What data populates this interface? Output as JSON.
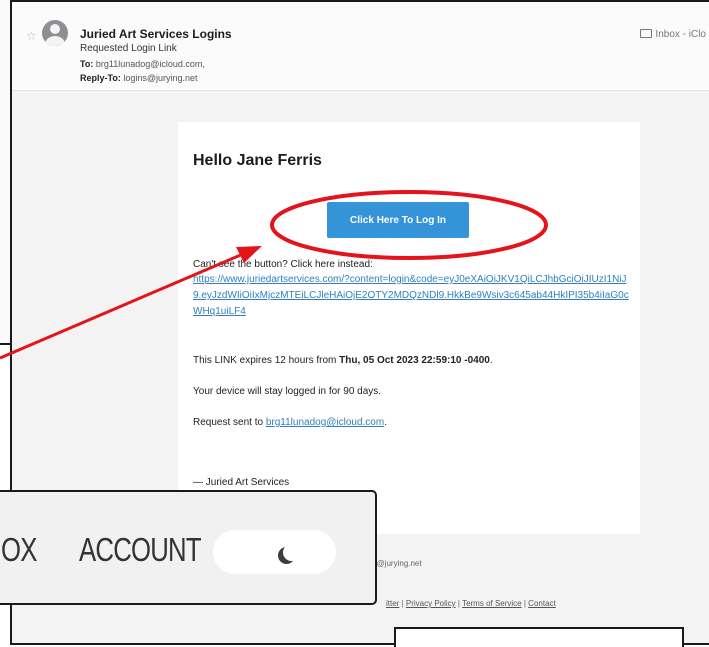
{
  "email": {
    "sender": "Juried Art Services Logins",
    "subject": "Requested Login Link",
    "to_label": "To:",
    "to_value": "brg11lunadog@icloud.com,",
    "reply_label": "Reply-To:",
    "reply_value": "logins@jurying.net",
    "mailbox": "Inbox - iClo"
  },
  "body": {
    "greeting": "Hello Jane Ferris",
    "button_label": "Click Here To Log In",
    "cant_see": "Can't see the button? Click here instead:",
    "link": "https://www.juriedartservices.com/?content=login&code=eyJ0eXAiOiJKV1QiLCJhbGciOiJIUzI1NiJ9.eyJzdWIiOiIxMjczMTEiLCJleHAiOjE2OTY2MDQzNDl9.HkkBe9Wsiv3c645ab44HkIPI35b4iIaG0cWHq1uiLF4",
    "expires_prefix": "This LINK expires 12 hours from ",
    "expires_date": "Thu, 05 Oct 2023 22:59:10 -0400",
    "expires_suffix": ".",
    "device": "Your device will stay logged in for 90 days.",
    "request_prefix": "Request sent to ",
    "request_email": "brg11lunadog@icloud.com",
    "request_suffix": ".",
    "signoff": "— Juried Art Services"
  },
  "footer": {
    "sent_by": "by logins@jurying.net",
    "link_twitter": "itter",
    "sep": " | ",
    "link_privacy": "Privacy Policy",
    "link_terms": "Terms of Service",
    "link_contact": "Contact"
  },
  "account_bar": {
    "item_inbox": "OX",
    "item_account": "ACCOUNT",
    "toggle_icon": "moon-icon"
  },
  "colors": {
    "button": "#3593d8",
    "link": "#2f7fc2",
    "annotation": "#e3141b"
  }
}
